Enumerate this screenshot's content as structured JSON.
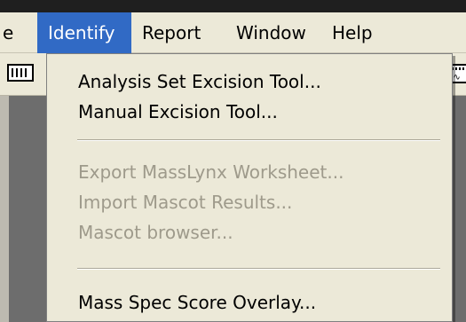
{
  "menubar": {
    "items": [
      {
        "label": "e",
        "active": false
      },
      {
        "label": "Identify",
        "active": true
      },
      {
        "label": "Report",
        "active": false
      },
      {
        "label": "Window",
        "active": false
      },
      {
        "label": "Help",
        "active": false
      }
    ]
  },
  "identify_menu": {
    "items": [
      {
        "label": "Analysis Set Excision Tool...",
        "enabled": true
      },
      {
        "label": "Manual Excision Tool...",
        "enabled": true
      },
      {
        "label": "Export MassLynx Worksheet...",
        "enabled": false
      },
      {
        "label": "Import Mascot Results...",
        "enabled": false
      },
      {
        "label": "Mascot browser...",
        "enabled": false
      },
      {
        "label": "Mass Spec Score Overlay...",
        "enabled": true
      }
    ]
  },
  "colors": {
    "menu_bg": "#ece9d8",
    "highlight": "#316ac5",
    "disabled_text": "#9e9a8b",
    "workspace": "#6d6d6d"
  },
  "icons": [
    "grid-toolbar-icon",
    "waveform-toolbar-icon"
  ]
}
